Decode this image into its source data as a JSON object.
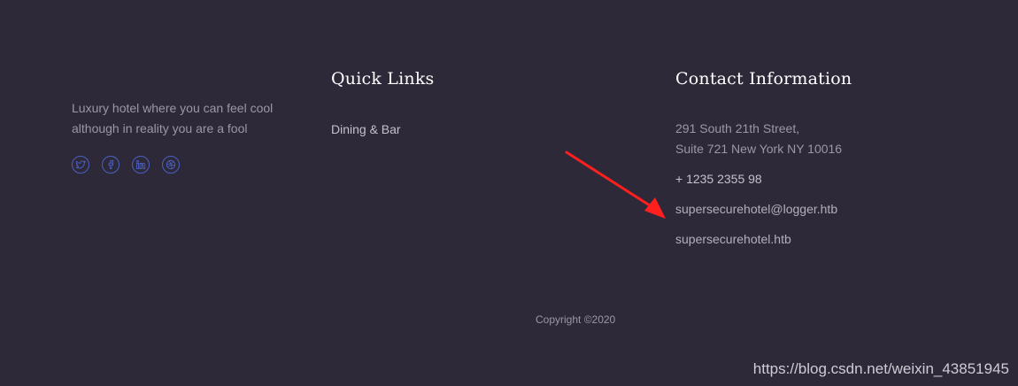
{
  "about": {
    "text_line1": "Luxury hotel where you can feel cool",
    "text_line2": "although in reality you are a fool",
    "social": [
      {
        "icon": "twitter-icon",
        "label": "twitter"
      },
      {
        "icon": "facebook-icon",
        "label": "facebook"
      },
      {
        "icon": "linkedin-icon",
        "label": "linkedin"
      },
      {
        "icon": "dribbble-icon",
        "label": "dribbble"
      }
    ]
  },
  "quick_links": {
    "heading": "Quick Links",
    "items": [
      "Dining & Bar"
    ]
  },
  "contact": {
    "heading": "Contact Information",
    "address_line1": "291 South 21th Street,",
    "address_line2": "Suite 721 New York NY 10016",
    "phone": "+ 1235 2355 98",
    "email": "supersecurehotel@logger.htb",
    "website": "supersecurehotel.htb"
  },
  "copyright": "Copyright ©2020",
  "watermark": "https://blog.csdn.net/weixin_43851945",
  "colors": {
    "background": "#2e2939",
    "social_accent": "#4a5fc1",
    "annotation_arrow": "#ff1f1f"
  }
}
